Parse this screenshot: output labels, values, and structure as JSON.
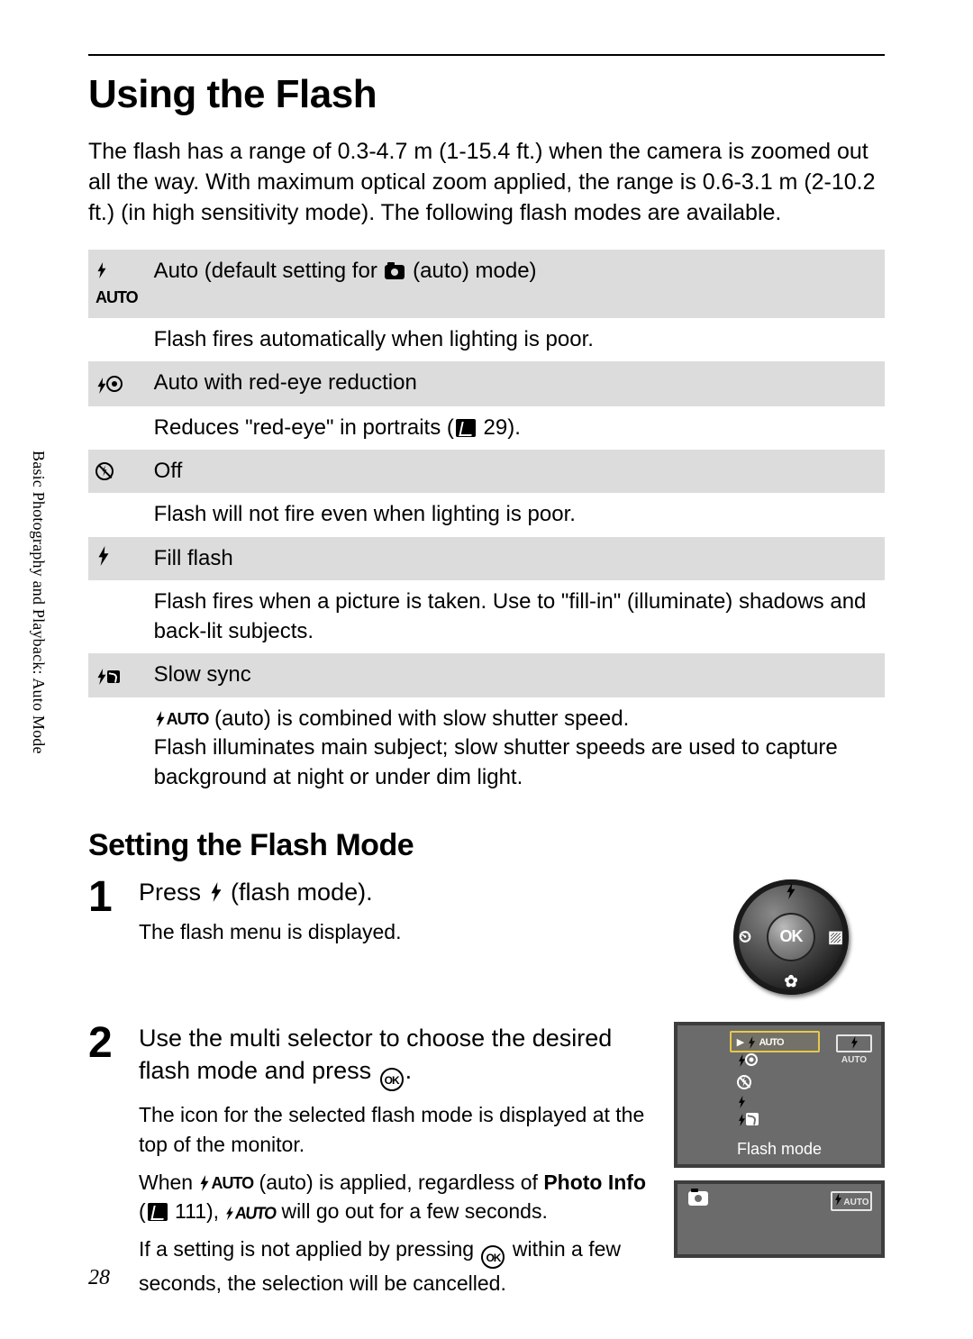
{
  "sideLabel": "Basic Photography and Playback: Auto Mode",
  "title": "Using the Flash",
  "intro": "The flash has a range of 0.3-4.7 m (1-15.4 ft.) when the camera is zoomed out all the way. With maximum optical zoom applied, the range is 0.6-3.1 m (2-10.2 ft.) (in high sensitivity mode). The following flash modes are available.",
  "modes": {
    "auto": {
      "label_pre": "Auto (default setting for ",
      "label_post": " (auto) mode)",
      "desc": "Flash fires automatically when lighting is poor."
    },
    "redeye": {
      "label": "Auto with red-eye reduction",
      "desc_pre": "Reduces \"red-eye\" in portraits (",
      "desc_ref": " 29).",
      "pageRef": "29"
    },
    "off": {
      "label": "Off",
      "desc": "Flash will not fire even when lighting is poor."
    },
    "fill": {
      "label": "Fill flash",
      "desc": "Flash fires when a picture is taken. Use to \"fill-in\" (illuminate) shadows and back-lit subjects."
    },
    "slow": {
      "label": "Slow sync",
      "desc_line1_post": " (auto) is combined with slow shutter speed.",
      "desc_line2": "Flash illuminates main subject; slow shutter speeds are used to capture background at night or under dim light."
    },
    "autoLabel": "AUTO"
  },
  "section2": "Setting the Flash Mode",
  "steps": {
    "s1": {
      "num": "1",
      "head_pre": "Press ",
      "head_post": " (flash mode).",
      "p1": "The flash menu is displayed.",
      "wheelCenter": "OK"
    },
    "s2": {
      "num": "2",
      "head": "Use the multi selector to choose the desired flash mode and press ",
      "head_post": ".",
      "p1": "The icon for the selected flash mode is displayed at the top of the monitor.",
      "p2_pre": "When ",
      "p2_mid": " (auto) is applied, regardless of ",
      "p2_bold": "Photo Info",
      "p2_ref": " 111), ",
      "p2_refNum": "111",
      "p2_post": " will go out for a few seconds.",
      "p3_pre": "If a setting is not applied by pressing ",
      "p3_post": " within a few seconds, the selection will be cancelled.",
      "lcd1": {
        "caption": "Flash mode",
        "menu": [
          "AUTO",
          "redeye",
          "off",
          "fill",
          "slow"
        ],
        "sideIconLabel": "AUTO"
      },
      "lcd2": {
        "sideIconLabel": "AUTO"
      },
      "dispAutoLabel": "AUTO"
    }
  },
  "pageNumber": "28"
}
